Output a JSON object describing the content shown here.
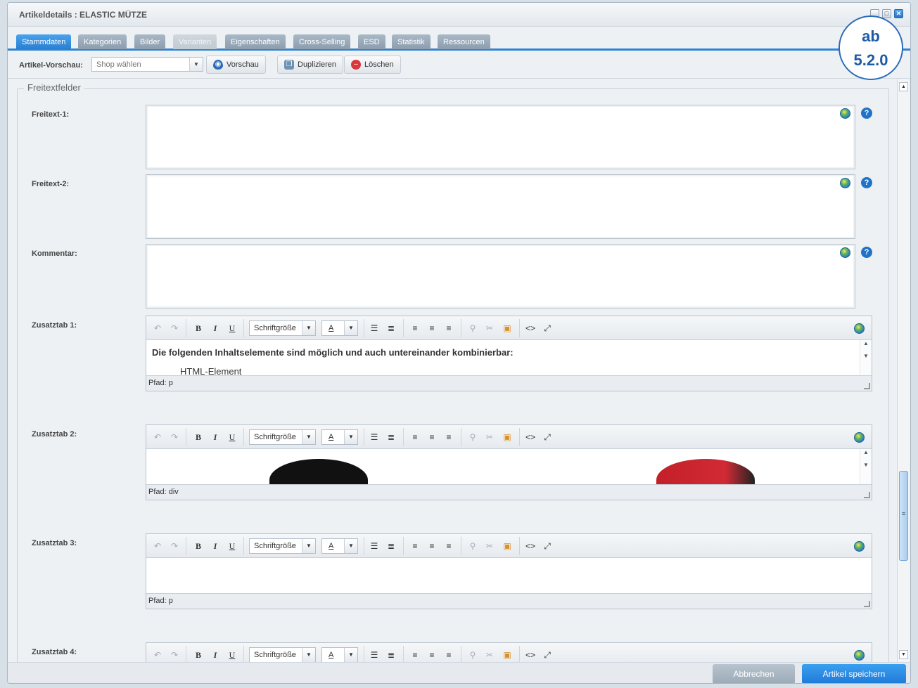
{
  "window": {
    "title": "Artikeldetails : ELASTIC MÜTZE",
    "buttons": {
      "minimize": "_",
      "maximize": "□",
      "close": "✕"
    }
  },
  "badge": {
    "line1": "ab",
    "line2": "5.2.0"
  },
  "tabs": [
    {
      "label": "Stammdaten",
      "state": "active"
    },
    {
      "label": "Kategorien",
      "state": "normal"
    },
    {
      "label": "Bilder",
      "state": "normal"
    },
    {
      "label": "Varianten",
      "state": "disabled"
    },
    {
      "label": "Eigenschaften",
      "state": "normal"
    },
    {
      "label": "Cross-Selling",
      "state": "normal"
    },
    {
      "label": "ESD",
      "state": "normal"
    },
    {
      "label": "Statistik",
      "state": "normal"
    },
    {
      "label": "Ressourcen",
      "state": "normal"
    }
  ],
  "toolbar": {
    "preview_label": "Artikel-Vorschau:",
    "shop_placeholder": "Shop wählen",
    "preview_button": "Vorschau",
    "duplicate_button": "Duplizieren",
    "delete_button": "Löschen"
  },
  "fieldset": {
    "legend": "Freitextfelder"
  },
  "fields": [
    {
      "label": "Freitext-1:",
      "value": ""
    },
    {
      "label": "Freitext-2:",
      "value": ""
    },
    {
      "label": "Kommentar:",
      "value": ""
    }
  ],
  "editor_toolbar": {
    "font_size_label": "Schriftgröße",
    "color_glyph": "A",
    "bold": "B",
    "italic": "I",
    "underline": "U"
  },
  "editors": [
    {
      "label": "Zusatztab 1:",
      "content": "Die folgenden Inhaltselemente sind möglich und auch untereinander kombinierbar:",
      "content_partial": "HTML-Element",
      "path": "Pfad: p"
    },
    {
      "label": "Zusatztab 2:",
      "content": "",
      "path": "Pfad: div"
    },
    {
      "label": "Zusatztab 3:",
      "content": "",
      "path": "Pfad: p"
    },
    {
      "label": "Zusatztab 4:",
      "content": "",
      "path": ""
    }
  ],
  "footer": {
    "cancel": "Abbrechen",
    "save": "Artikel speichern"
  },
  "colors": {
    "accent": "#2d84d2",
    "save": "#1e7ad8",
    "cancel": "#9caab7"
  }
}
